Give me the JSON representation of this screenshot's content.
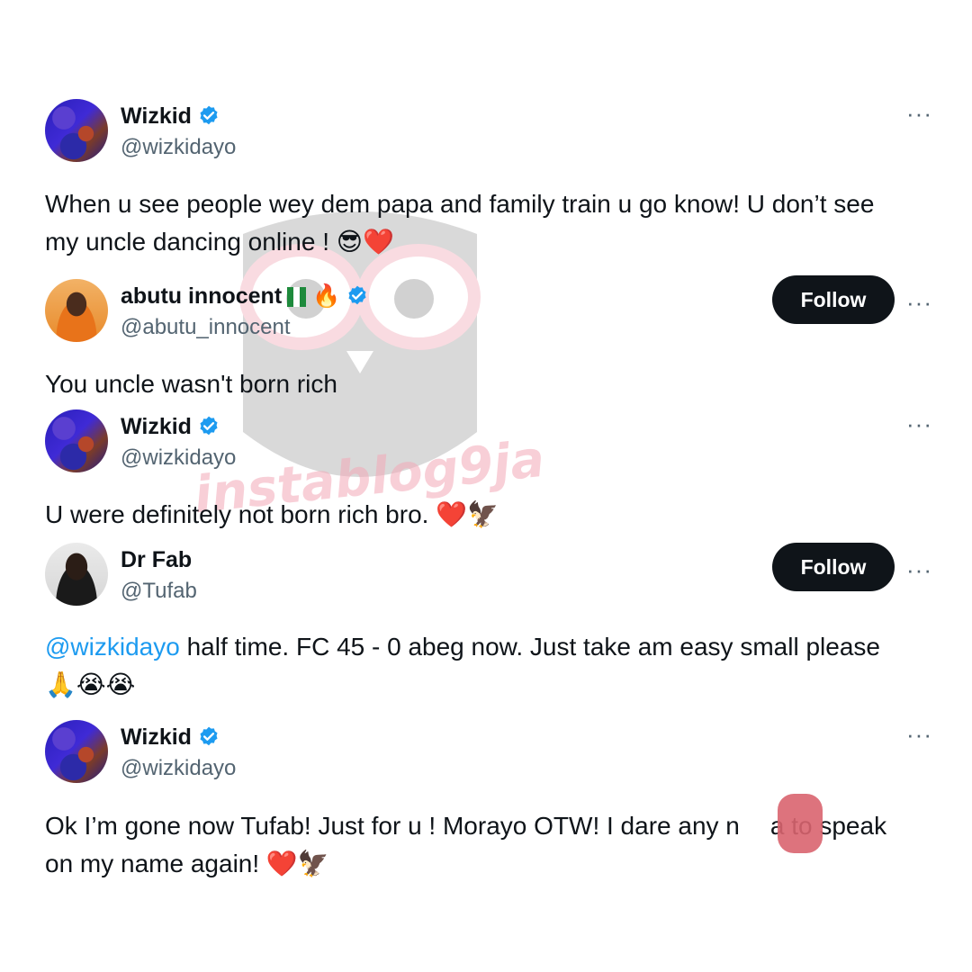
{
  "tweets": [
    {
      "name": "Wizkid",
      "handle": "@wizkidayo",
      "verified": true,
      "follow_label": "",
      "text": "When u see people wey dem papa and family train u go know! U don’t see my uncle dancing online !",
      "emojis": "😎❤️"
    },
    {
      "name": "abutu innocent",
      "name_emojis": "🔥",
      "handle": "@abutu_innocent",
      "verified": true,
      "follow_label": "Follow",
      "text": "You uncle wasn't born rich",
      "emojis": ""
    },
    {
      "name": "Wizkid",
      "handle": "@wizkidayo",
      "verified": true,
      "follow_label": "",
      "text": "U were definitely not born rich bro.",
      "emojis": "❤️🦅"
    },
    {
      "name": "Dr Fab",
      "handle": "@Tufab",
      "verified": false,
      "follow_label": "Follow",
      "mention": "@wizkidayo",
      "text": "half time. FC 45 - 0 abeg now. Just take am easy small please",
      "emojis": "🙏😭😭"
    },
    {
      "name": "Wizkid",
      "handle": "@wizkidayo",
      "verified": true,
      "follow_label": "",
      "text_before": "Ok I’m gone now Tufab! Just for u ! Morayo OTW! I dare any n",
      "text_after": "a to speak on my name again!",
      "emojis": "❤️🦅"
    }
  ],
  "more_label": "···",
  "watermark": "instablog9ja",
  "colors": {
    "verified": "#1d9bf0",
    "mention": "#1d9bf0",
    "handle": "#536471",
    "follow_bg": "#0f1419"
  },
  "icons": {
    "verified": "verified-badge-icon",
    "more": "more-options-icon"
  }
}
